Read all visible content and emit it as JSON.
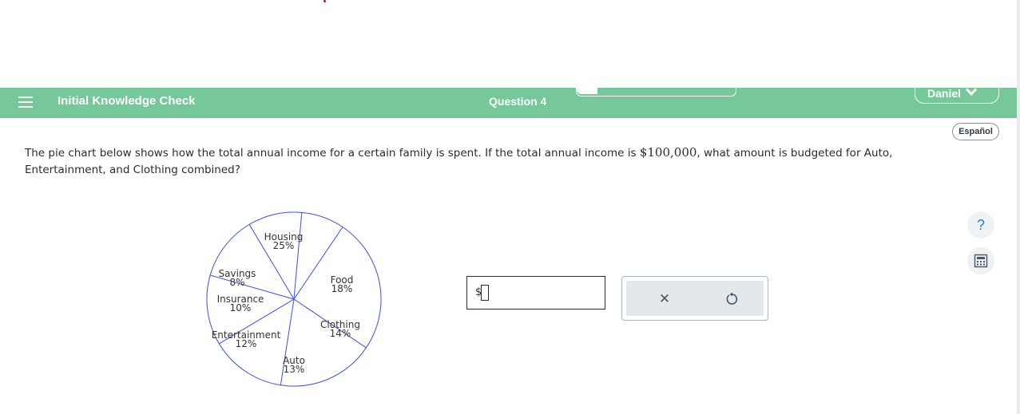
{
  "header": {
    "title": "Initial Knowledge Check",
    "question_label": "Question 4",
    "progress_fraction": 0.13,
    "user_name": "Daniel"
  },
  "language_button": "Español",
  "question": {
    "text_before": "The pie chart below shows how the total annual income for a certain family is spent. If the total annual income is ",
    "amount": "$100,000",
    "text_after": ", what amount is budgeted for Auto, Entertainment, and Clothing combined?"
  },
  "answer": {
    "prefix": "$",
    "value": ""
  },
  "tools": {
    "clear_icon": "close-icon",
    "undo_icon": "undo-icon"
  },
  "side_tools": {
    "help_label": "?",
    "calculator_icon": "calculator-icon"
  },
  "colors": {
    "header_bg": "#76c79a",
    "pie_stroke": "#4a5bd8"
  },
  "chart_data": {
    "type": "pie",
    "slices": [
      {
        "label": "Housing",
        "percent_label": "25%",
        "value": 25
      },
      {
        "label": "Food",
        "percent_label": "18%",
        "value": 18
      },
      {
        "label": "Clothing",
        "percent_label": "14%",
        "value": 14
      },
      {
        "label": "Auto",
        "percent_label": "13%",
        "value": 13
      },
      {
        "label": "Entertainment",
        "percent_label": "12%",
        "value": 12
      },
      {
        "label": "Insurance",
        "percent_label": "10%",
        "value": 10
      },
      {
        "label": "Savings",
        "percent_label": "8%",
        "value": 8
      }
    ],
    "title": ""
  }
}
